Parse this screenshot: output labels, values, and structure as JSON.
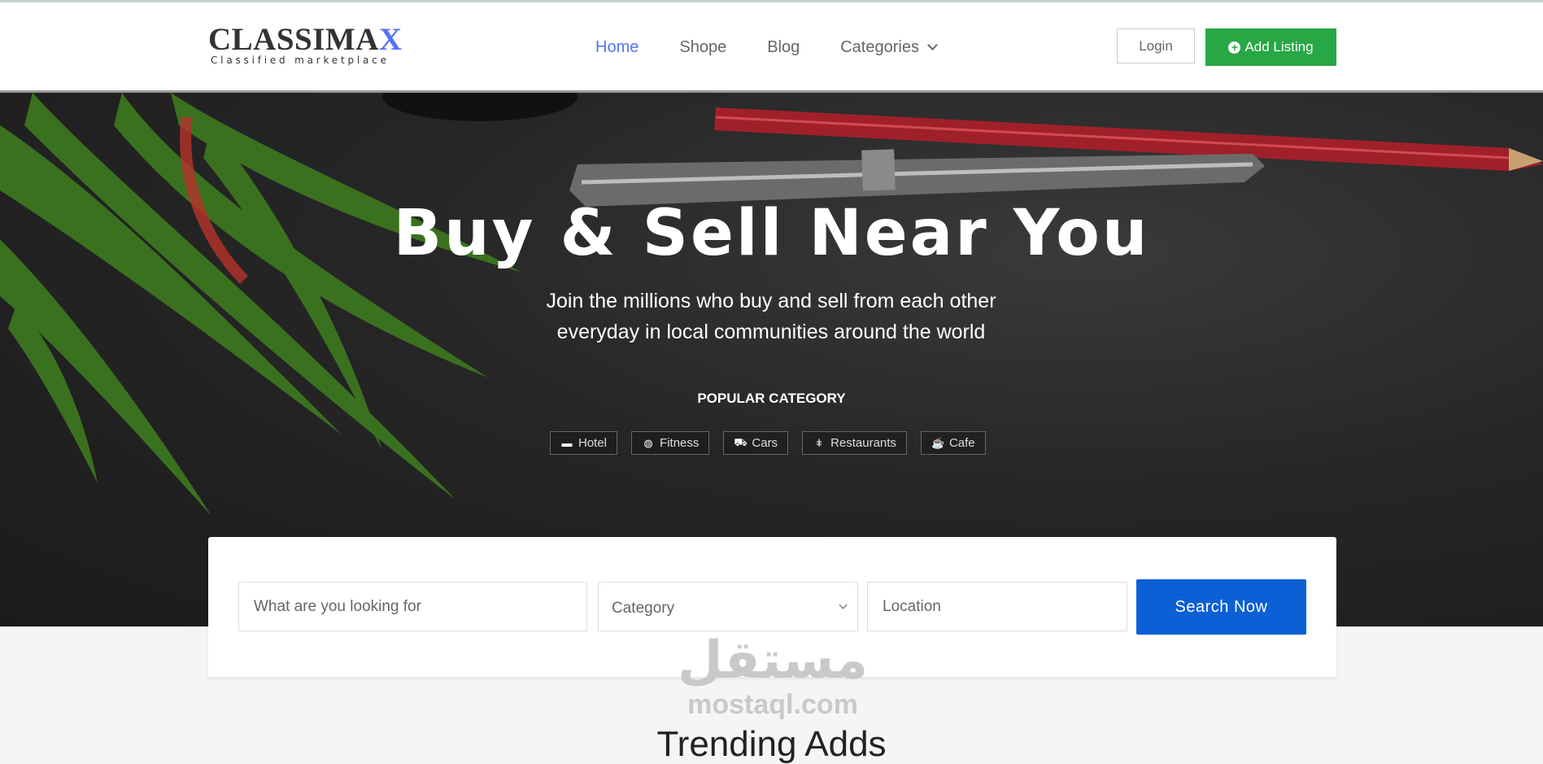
{
  "header": {
    "logo_main": "CLASSIMA",
    "logo_accent": "X",
    "logo_sub": "Classified marketplace",
    "nav": [
      {
        "label": "Home",
        "active": true
      },
      {
        "label": "Shope"
      },
      {
        "label": "Blog"
      },
      {
        "label": "Categories"
      }
    ],
    "login_label": "Login",
    "add_listing_label": "Add Listing"
  },
  "hero": {
    "title": "Buy & Sell Near You",
    "subtitle_line1": "Join the millions who buy and sell from each other",
    "subtitle_line2": "everyday in local communities around the world",
    "popular_label": "POPULAR CATEGORY",
    "categories": [
      {
        "label": "Hotel",
        "icon": "bed-icon"
      },
      {
        "label": "Fitness",
        "icon": "basketball-icon"
      },
      {
        "label": "Cars",
        "icon": "car-icon"
      },
      {
        "label": "Restaurants",
        "icon": "cutlery-icon"
      },
      {
        "label": "Cafe",
        "icon": "coffee-icon"
      }
    ]
  },
  "search": {
    "keyword_placeholder": "What are you looking for",
    "category_value": "Category",
    "location_placeholder": "Location",
    "button_label": "Search Now"
  },
  "watermark": {
    "arabic": "مستقل",
    "latin": "mostaql.com"
  },
  "section_title": "Trending Adds",
  "colors": {
    "accent": "#5672f9",
    "add_button": "#28a745",
    "search_button": "#0c60d5"
  }
}
